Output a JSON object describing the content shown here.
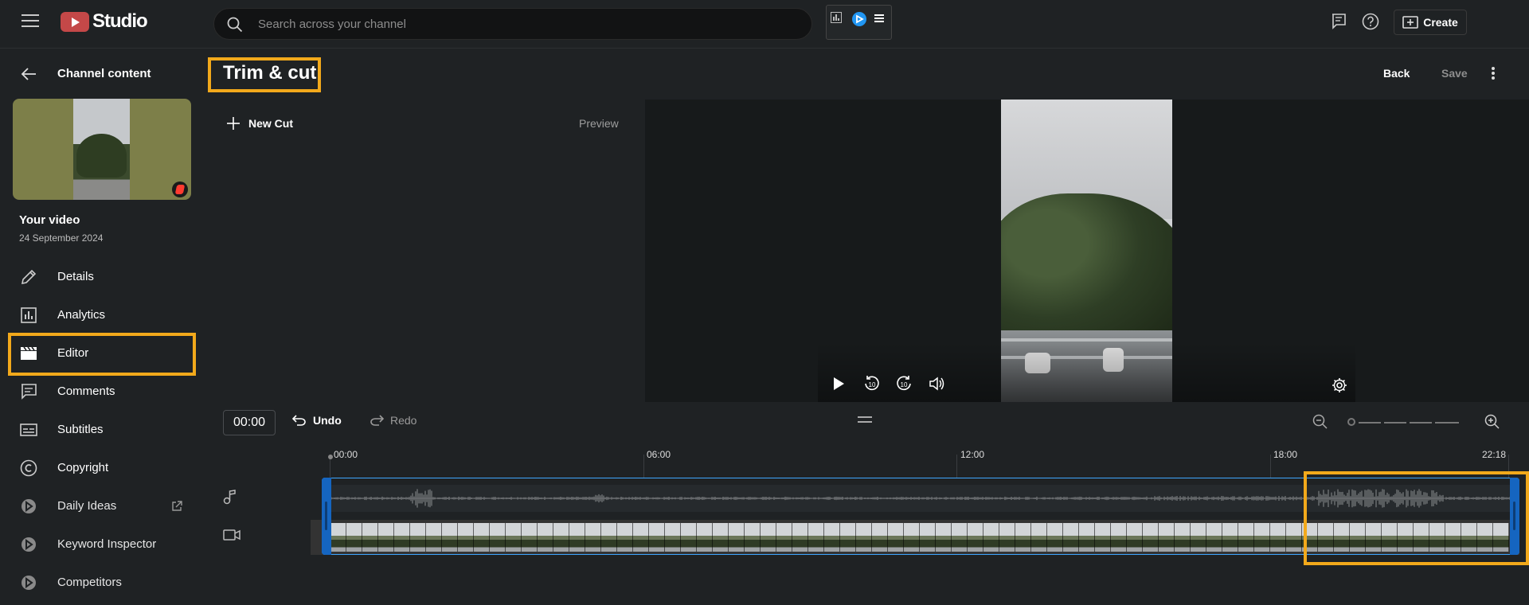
{
  "app": {
    "logo_text": "Studio"
  },
  "search": {
    "placeholder": "Search across your channel"
  },
  "header": {
    "create_label": "Create"
  },
  "sidebar": {
    "back_label": "Channel content",
    "video_title": "Your video",
    "video_date": "24 September 2024",
    "items": [
      {
        "label": "Details",
        "icon": "pencil-icon"
      },
      {
        "label": "Analytics",
        "icon": "analytics-icon"
      },
      {
        "label": "Editor",
        "icon": "clapperboard-icon"
      },
      {
        "label": "Comments",
        "icon": "comments-icon"
      },
      {
        "label": "Subtitles",
        "icon": "subtitles-icon"
      },
      {
        "label": "Copyright",
        "icon": "copyright-icon"
      },
      {
        "label": "Daily Ideas",
        "icon": "extension-icon"
      },
      {
        "label": "Keyword Inspector",
        "icon": "extension-icon"
      },
      {
        "label": "Competitors",
        "icon": "extension-icon"
      }
    ]
  },
  "editor": {
    "title": "Trim & cut",
    "back_label": "Back",
    "save_label": "Save",
    "new_cut_label": "New Cut",
    "preview_label": "Preview",
    "current_time": "00:00",
    "undo_label": "Undo",
    "redo_label": "Redo",
    "ruler_labels": [
      "00:00",
      "06:00",
      "12:00",
      "18:00",
      "22:18"
    ]
  },
  "colors": {
    "accent": "#3ea6ff",
    "highlight": "#f2a91b",
    "brand": "#c44848"
  }
}
